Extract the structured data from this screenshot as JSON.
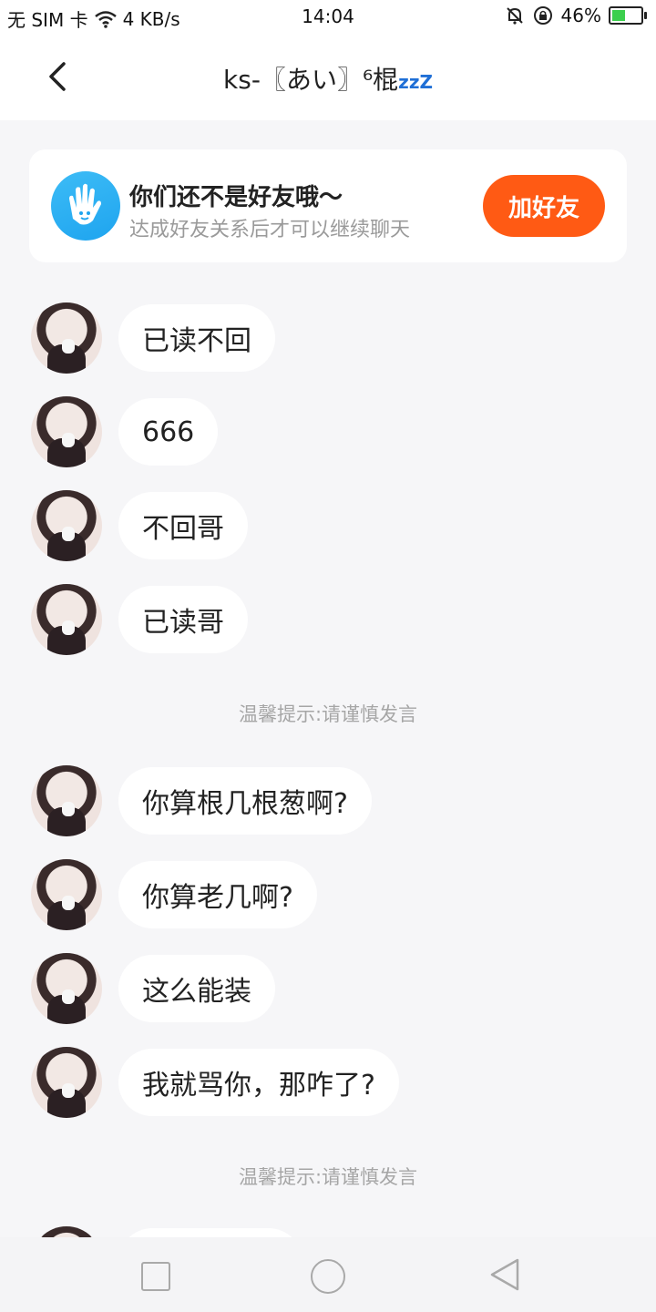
{
  "status_bar": {
    "carrier": "无 SIM 卡",
    "speed": "4 KB/s",
    "time": "14:04",
    "battery_percent": "46%",
    "battery_level": 0.46
  },
  "header": {
    "title": "ks-〖あい〗⁶棍",
    "title_suffix": "zzZ"
  },
  "friend_banner": {
    "title": "你们还不是好友哦～",
    "subtitle": "达成好友关系后才可以继续聊天",
    "button_label": "加好友",
    "accent": "#ff5a14"
  },
  "messages": [
    {
      "text": "已读不回"
    },
    {
      "text": "666"
    },
    {
      "text": "不回哥"
    },
    {
      "text": "已读哥"
    },
    {
      "text": "你算根几根葱啊?"
    },
    {
      "text": "你算老几啊?"
    },
    {
      "text": "这么能装"
    },
    {
      "text": "我就骂你，那咋了?"
    }
  ],
  "tips": [
    "温馨提示:请谨慎发言",
    "温馨提示:请谨慎发言"
  ]
}
